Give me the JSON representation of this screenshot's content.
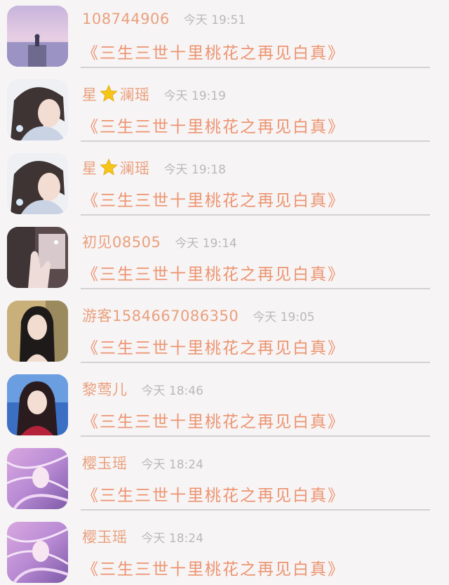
{
  "messages": [
    {
      "nick_before": "108744906",
      "nick_after": "",
      "time": "今天 19:51",
      "text": "《三生三世十里桃花之再见白真》",
      "avatar_icon": "lake-sunset-avatar"
    },
    {
      "nick_before": "星",
      "nick_after": "澜瑶",
      "time": "今天 19:19",
      "text": "《三生三世十里桃花之再见白真》",
      "avatar_icon": "anime-girl-avatar"
    },
    {
      "nick_before": "星",
      "nick_after": "澜瑶",
      "time": "今天 19:18",
      "text": "《三生三世十里桃花之再见白真》",
      "avatar_icon": "anime-girl-avatar"
    },
    {
      "nick_before": "初见08505",
      "nick_after": "",
      "time": "今天 19:14",
      "text": "《三生三世十里桃花之再见白真》",
      "avatar_icon": "hand-photo-avatar"
    },
    {
      "nick_before": "游客1584667086350",
      "nick_after": "",
      "time": "今天 19:05",
      "text": "《三生三世十里桃花之再见白真》",
      "avatar_icon": "girl-portrait-avatar"
    },
    {
      "nick_before": "黎莺儿",
      "nick_after": "",
      "time": "今天 18:46",
      "text": "《三生三世十里桃花之再见白真》",
      "avatar_icon": "girl-blue-background-avatar"
    },
    {
      "nick_before": "樱玉瑶",
      "nick_after": "",
      "time": "今天 18:24",
      "text": "《三生三世十里桃花之再见白真》",
      "avatar_icon": "purple-anime-avatar"
    },
    {
      "nick_before": "樱玉瑶",
      "nick_after": "",
      "time": "今天 18:24",
      "text": "《三生三世十里桃花之再见白真》",
      "avatar_icon": "purple-anime-avatar"
    }
  ],
  "colors": {
    "nickname": "#e9a07d",
    "time": "#b9b9b9",
    "message": "#ec9470",
    "divider": "#d2d2d2",
    "background": "#f7f4f5",
    "star": "#f5c518"
  }
}
